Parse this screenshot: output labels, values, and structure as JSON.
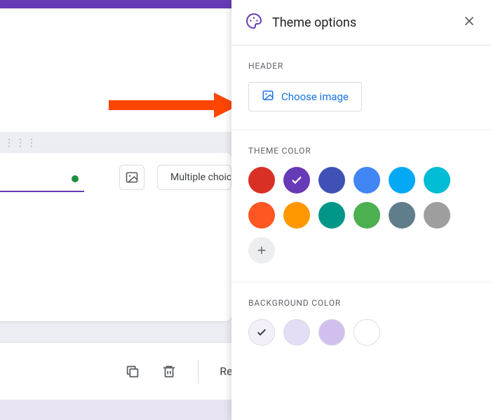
{
  "panel": {
    "title": "Theme options",
    "sections": {
      "header": {
        "label": "HEADER",
        "choose_image_label": "Choose image"
      },
      "theme_color": {
        "label": "THEME COLOR",
        "colors": [
          {
            "hex": "#d93025",
            "selected": false
          },
          {
            "hex": "#673ab7",
            "selected": true
          },
          {
            "hex": "#3f51b5",
            "selected": false
          },
          {
            "hex": "#4285f4",
            "selected": false
          },
          {
            "hex": "#03a9f4",
            "selected": false
          },
          {
            "hex": "#00bcd4",
            "selected": false
          },
          {
            "hex": "#ff5722",
            "selected": false
          },
          {
            "hex": "#ff9800",
            "selected": false
          },
          {
            "hex": "#009688",
            "selected": false
          },
          {
            "hex": "#4caf50",
            "selected": false
          },
          {
            "hex": "#607d8b",
            "selected": false
          },
          {
            "hex": "#9e9e9e",
            "selected": false
          }
        ]
      },
      "background_color": {
        "label": "BACKGROUND COLOR",
        "colors": [
          {
            "hex": "#f3f0f9",
            "selected": true
          },
          {
            "hex": "#e5dcf6",
            "selected": false
          },
          {
            "hex": "#d1c0ee",
            "selected": false
          },
          {
            "hex": "#ffffff",
            "selected": false
          }
        ]
      }
    }
  },
  "background_ui": {
    "question_type_label": "Multiple choice",
    "toolbar_record_label": "Rec"
  }
}
